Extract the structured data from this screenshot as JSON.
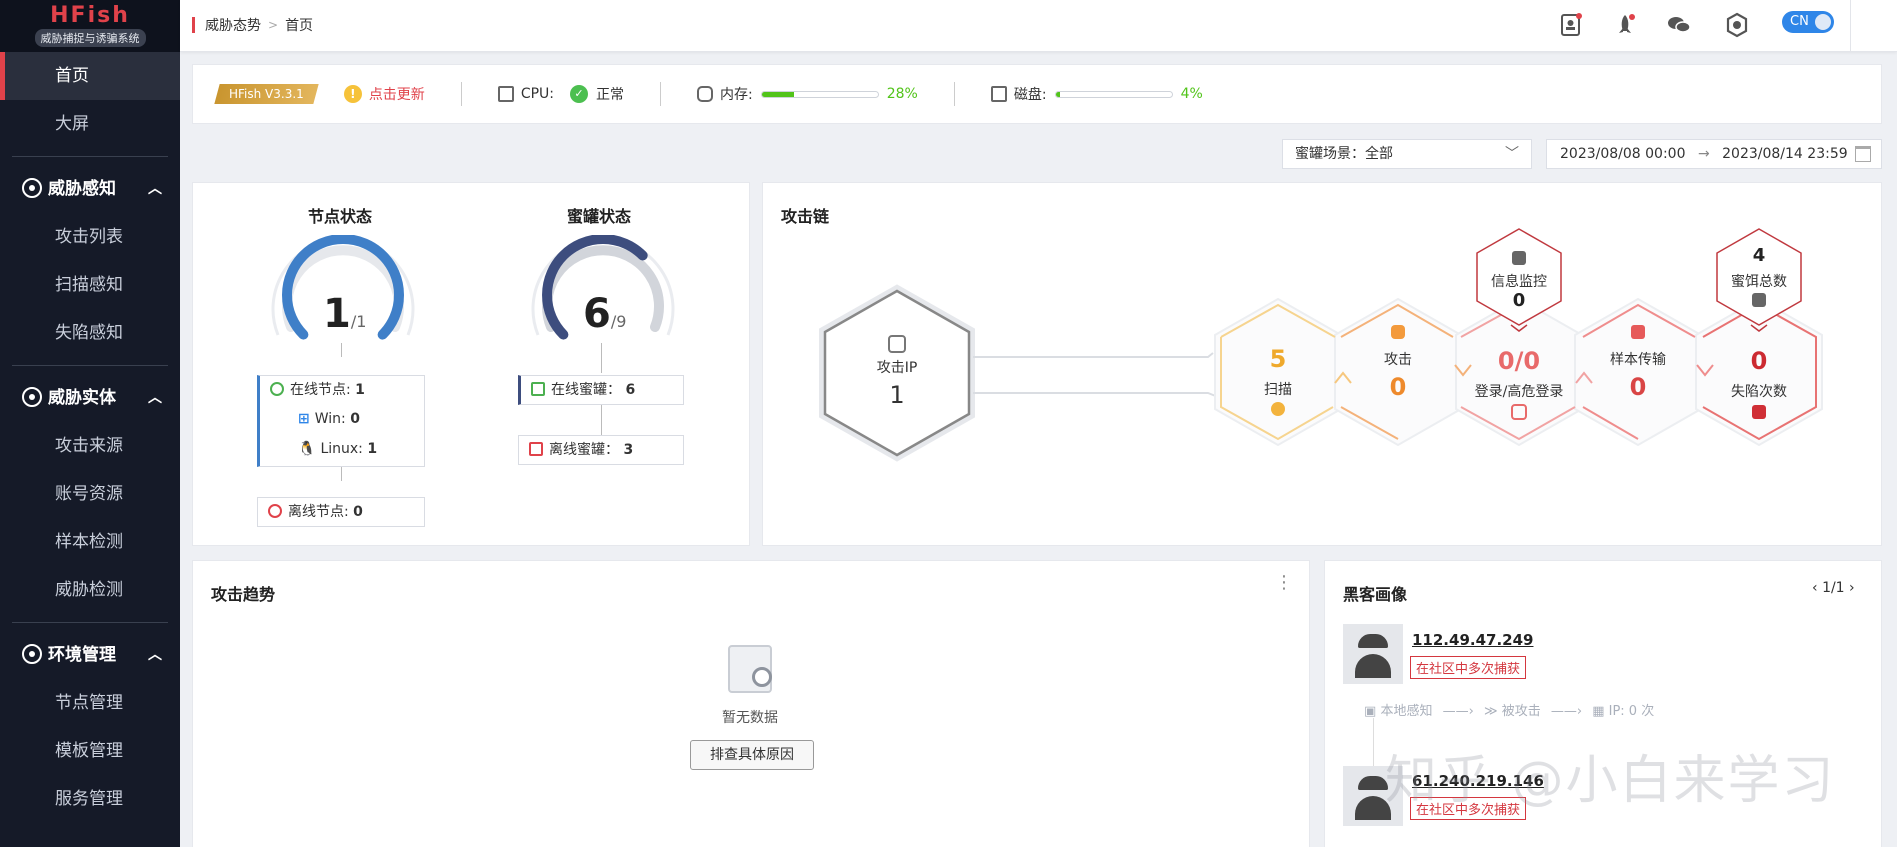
{
  "sidebar": {
    "brand": "HFish",
    "subtitle": "威胁捕捉与诱骗系统",
    "top_items": [
      {
        "label": "首页"
      },
      {
        "label": "大屏"
      }
    ],
    "groups": [
      {
        "label": "威胁感知",
        "items": [
          "攻击列表",
          "扫描感知",
          "失陷感知"
        ]
      },
      {
        "label": "威胁实体",
        "items": [
          "攻击来源",
          "账号资源",
          "样本检测",
          "威胁检测"
        ]
      },
      {
        "label": "环境管理",
        "items": [
          "节点管理",
          "模板管理",
          "服务管理"
        ]
      }
    ]
  },
  "topbar": {
    "breadcrumb": [
      "威胁态势",
      "首页"
    ],
    "lang": "CN",
    "icons": [
      "notebook-icon",
      "rocket-icon",
      "wechat-icon",
      "hexagon-settings-icon"
    ]
  },
  "status": {
    "version": "HFish V3.3.1",
    "update_label": "点击更新",
    "cpu_label": "CPU:",
    "cpu_status": "正常",
    "mem_label": "内存:",
    "mem_pct": "28%",
    "mem_value": 0.28,
    "disk_label": "磁盘:",
    "disk_pct": "4%",
    "disk_value": 0.04
  },
  "filter": {
    "scene": "蜜罐场景：全部",
    "date_start": "2023/08/08 00:00",
    "date_end": "2023/08/14 23:59"
  },
  "node_status": {
    "title": "节点状态",
    "value": "1",
    "total": "/1",
    "ratio": 1.0,
    "online_label": "在线节点: ",
    "online": "1",
    "win_label": "Win: ",
    "win": "0",
    "linux_label": "Linux: ",
    "linux": "1",
    "offline_label": "离线节点: ",
    "offline": "0"
  },
  "honey_status": {
    "title": "蜜罐状态",
    "value": "6",
    "total": "/9",
    "ratio": 0.667,
    "online_label": "在线蜜罐： ",
    "online": "6",
    "offline_label": "离线蜜罐： ",
    "offline": "3"
  },
  "attack_chain": {
    "title": "攻击链",
    "attack_ip_label": "攻击IP",
    "attack_ip": "1",
    "scan_label": "扫描",
    "scan": "5",
    "attack_label": "攻击",
    "attack": "0",
    "login_label": "登录/高危登录",
    "login": "0/0",
    "sample_label": "样本传输",
    "sample": "0",
    "fall_label": "失陷次数",
    "fall": "0",
    "info_label": "信息监控",
    "info": "0",
    "bait_label": "蜜饵总数",
    "bait": "4"
  },
  "trend": {
    "title": "攻击趋势",
    "empty": "暂无数据",
    "button": "排查具体原因"
  },
  "hackers": {
    "title": "黑客画像",
    "page": "1/1",
    "list": [
      {
        "ip": "112.49.47.249",
        "tag": "在社区中多次捕获"
      },
      {
        "ip": "61.240.219.146",
        "tag": "在社区中多次捕获"
      }
    ],
    "flow": [
      "本地感知",
      "被攻击",
      "IP: 0 次"
    ]
  },
  "watermark": "知乎 @小白来学习"
}
